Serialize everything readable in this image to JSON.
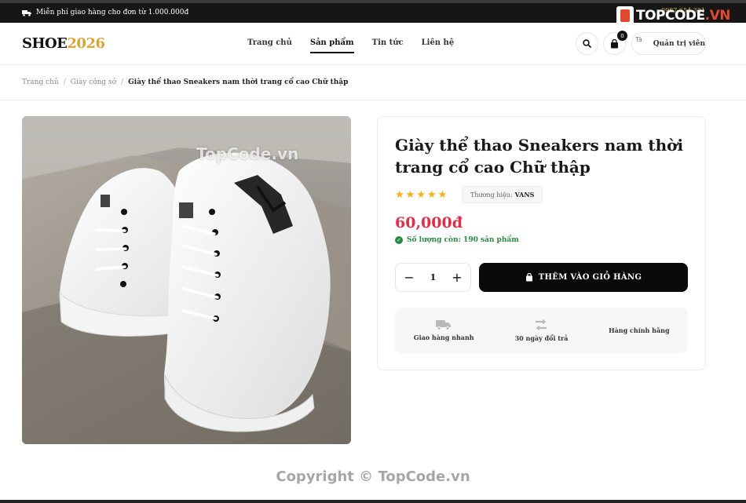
{
  "topbar": {
    "promo": "Miễn phí giao hàng cho đơn từ 1.000.000đ",
    "hotline": "0987.654.321"
  },
  "watermark": {
    "logo_main": "TOPCODE",
    "logo_suffix": ".VN",
    "center_text": "TopCode.vn",
    "copyright": "Copyright © TopCode.vn"
  },
  "header": {
    "brand_main": "SHOE",
    "brand_year": "2026",
    "nav": [
      {
        "label": "Trang chủ",
        "active": false
      },
      {
        "label": "Sản phẩm",
        "active": true
      },
      {
        "label": "Tin tức",
        "active": false
      },
      {
        "label": "Liên hệ",
        "active": false
      }
    ],
    "cart_count": "0",
    "account_avatar_alt": "Tà",
    "account_name": "Quản trị viên"
  },
  "breadcrumb": {
    "items": [
      "Trang chủ",
      "Giày công sở"
    ],
    "current": "Giày thể thao Sneakers nam thời trang cổ cao Chữ thập"
  },
  "product": {
    "title": "Giày thể thao Sneakers nam thời trang cổ cao Chữ thập",
    "rating": 5,
    "stars": [
      "★",
      "★",
      "★",
      "★",
      "★"
    ],
    "brand_label": "Thương hiệu:",
    "brand_value": "VANS",
    "price": "60,000đ",
    "stock_text": "Số lượng còn: 190 sản phẩm",
    "quantity": "1",
    "add_to_cart": "THÊM VÀO GIỎ HÀNG",
    "perks": [
      {
        "icon": "truck-icon",
        "label": "Giao hàng nhanh"
      },
      {
        "icon": "exchange-icon",
        "label": "30 ngày đổi trả"
      },
      {
        "icon": "",
        "label": "Hàng chính hãng"
      }
    ]
  },
  "colors": {
    "accent_gold": "#d9a537",
    "price_red": "#dc2f4a",
    "stock_green": "#2a8a40",
    "star_yellow": "#f5b21b",
    "button_black": "#0a0a0a"
  }
}
